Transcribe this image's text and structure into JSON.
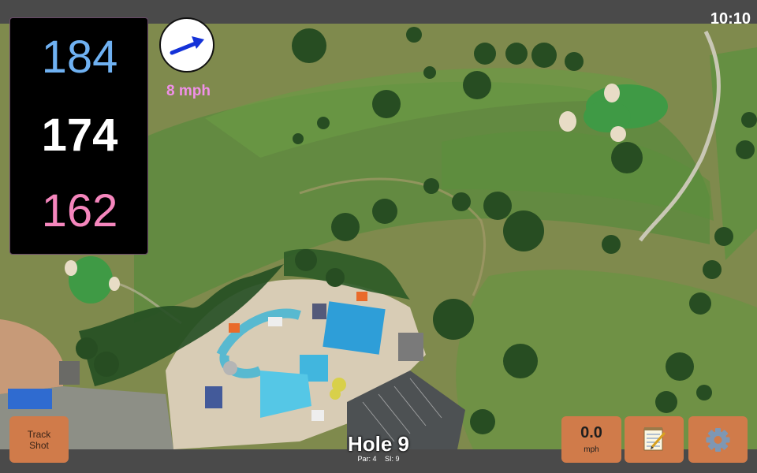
{
  "status_bar": {
    "time": "10:10"
  },
  "distances": {
    "back": "184",
    "middle": "174",
    "front": "162"
  },
  "wind": {
    "speed": "8 mph"
  },
  "hole": {
    "title": "Hole 9",
    "par": "Par: 4",
    "stroke_index": "SI: 9"
  },
  "buttons": {
    "track_shot_line1": "Track",
    "track_shot_line2": "Shot",
    "speed_value": "0.0",
    "speed_unit": "mph",
    "notes_icon": "notepad-icon",
    "settings_icon": "gear-icon"
  },
  "colors": {
    "back_distance": "#6fb1f2",
    "middle_distance": "#ffffff",
    "front_distance": "#f586bd",
    "wind_text": "#f090e8",
    "wind_arrow": "#1432d8",
    "button_orange": "#d07b4a"
  }
}
